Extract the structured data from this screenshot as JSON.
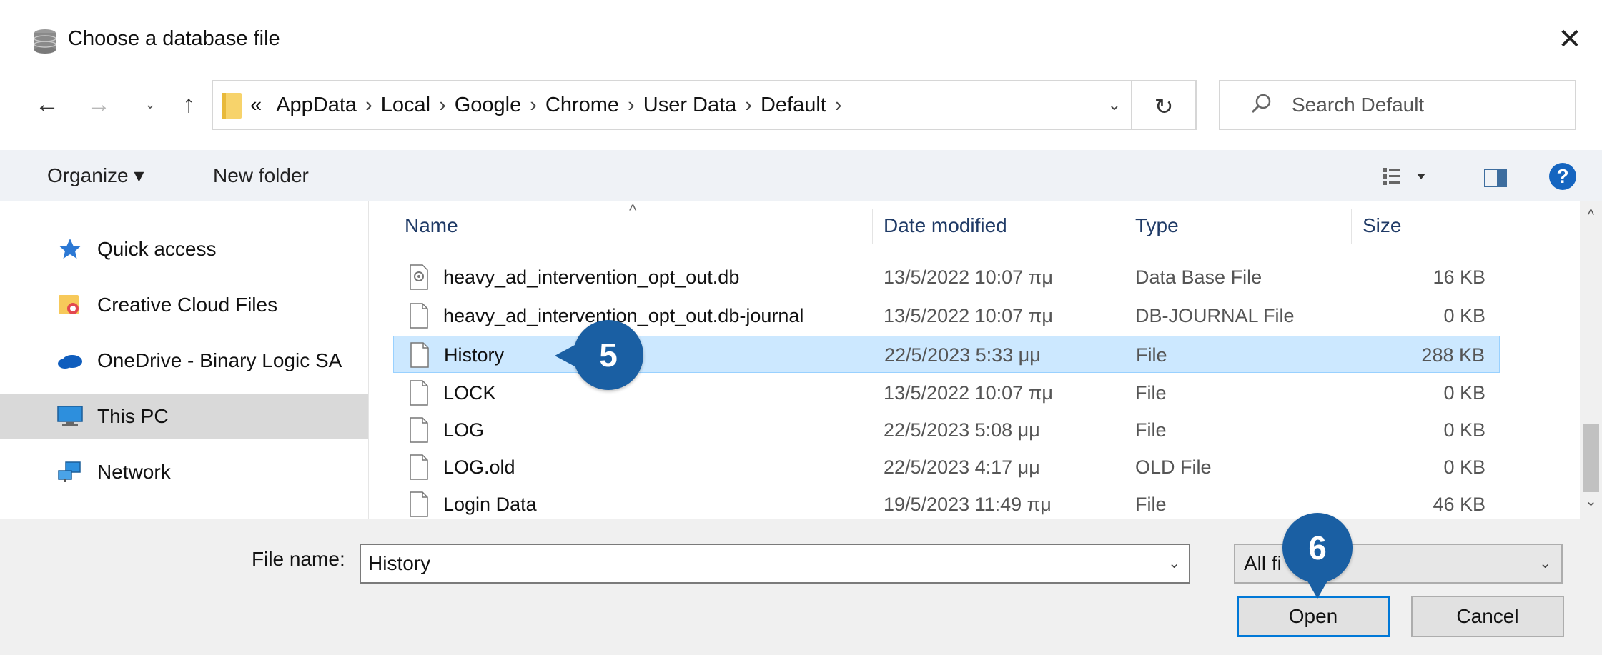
{
  "window": {
    "title": "Choose a database file",
    "close_glyph": "✕",
    "title_icon": "database-icon"
  },
  "nav": {
    "back_glyph": "←",
    "forward_glyph": "→",
    "recent_glyph": "⌄",
    "up_glyph": "↑"
  },
  "address": {
    "overflow": "«",
    "crumbs": [
      "AppData",
      "Local",
      "Google",
      "Chrome",
      "User Data",
      "Default"
    ],
    "separator": "›",
    "dropdown_glyph": "⌄",
    "refresh_glyph": "↻"
  },
  "search": {
    "placeholder": "Search Default",
    "icon": "search-icon"
  },
  "toolbar": {
    "organize": "Organize ▾",
    "new_folder": "New folder",
    "help": "?",
    "view_icon": "view-options-icon",
    "pane_icon": "preview-pane-icon"
  },
  "sidebar": {
    "items": [
      {
        "label": "Quick access",
        "icon": "star-icon",
        "selected": false
      },
      {
        "label": "Creative Cloud Files",
        "icon": "creative-cloud-folder-icon",
        "selected": false
      },
      {
        "label": "OneDrive - Binary Logic SA",
        "icon": "cloud-icon",
        "selected": false
      },
      {
        "label": "This PC",
        "icon": "computer-icon",
        "selected": true
      },
      {
        "label": "Network",
        "icon": "network-icon",
        "selected": false
      }
    ]
  },
  "columns": {
    "name": "Name",
    "date": "Date modified",
    "type": "Type",
    "size": "Size",
    "sort_glyph": "^"
  },
  "files": [
    {
      "name": "heavy_ad_intervention_opt_out.db",
      "date": "13/5/2022 10:07 πμ",
      "type": "Data Base File",
      "size": "16 KB",
      "icon": "database-file-icon"
    },
    {
      "name": "heavy_ad_intervention_opt_out.db-journal",
      "date": "13/5/2022 10:07 πμ",
      "type": "DB-JOURNAL File",
      "size": "0 KB",
      "icon": "file-icon"
    },
    {
      "name": "History",
      "date": "22/5/2023 5:33 μμ",
      "type": "File",
      "size": "288 KB",
      "icon": "file-icon",
      "selected": true
    },
    {
      "name": "LOCK",
      "date": "13/5/2022 10:07 πμ",
      "type": "File",
      "size": "0 KB",
      "icon": "file-icon"
    },
    {
      "name": "LOG",
      "date": "22/5/2023 5:08 μμ",
      "type": "File",
      "size": "0 KB",
      "icon": "file-icon"
    },
    {
      "name": "LOG.old",
      "date": "22/5/2023 4:17 μμ",
      "type": "OLD File",
      "size": "0 KB",
      "icon": "file-icon"
    },
    {
      "name": "Login Data",
      "date": "19/5/2023 11:49 πμ",
      "type": "File",
      "size": "46 KB",
      "icon": "file-icon"
    }
  ],
  "scroll": {
    "up_glyph": "^",
    "down_glyph": "⌄"
  },
  "footer": {
    "file_name_label": "File name:",
    "file_name_value": "History",
    "file_name_drop": "⌄",
    "filter_value": "All fi",
    "filter_drop": "⌄",
    "open": "Open",
    "cancel": "Cancel"
  },
  "callouts": {
    "step5": "5",
    "step6": "6"
  },
  "colors": {
    "accent": "#0078d7",
    "selection": "#cce8ff",
    "callout": "#1a5fa3"
  }
}
